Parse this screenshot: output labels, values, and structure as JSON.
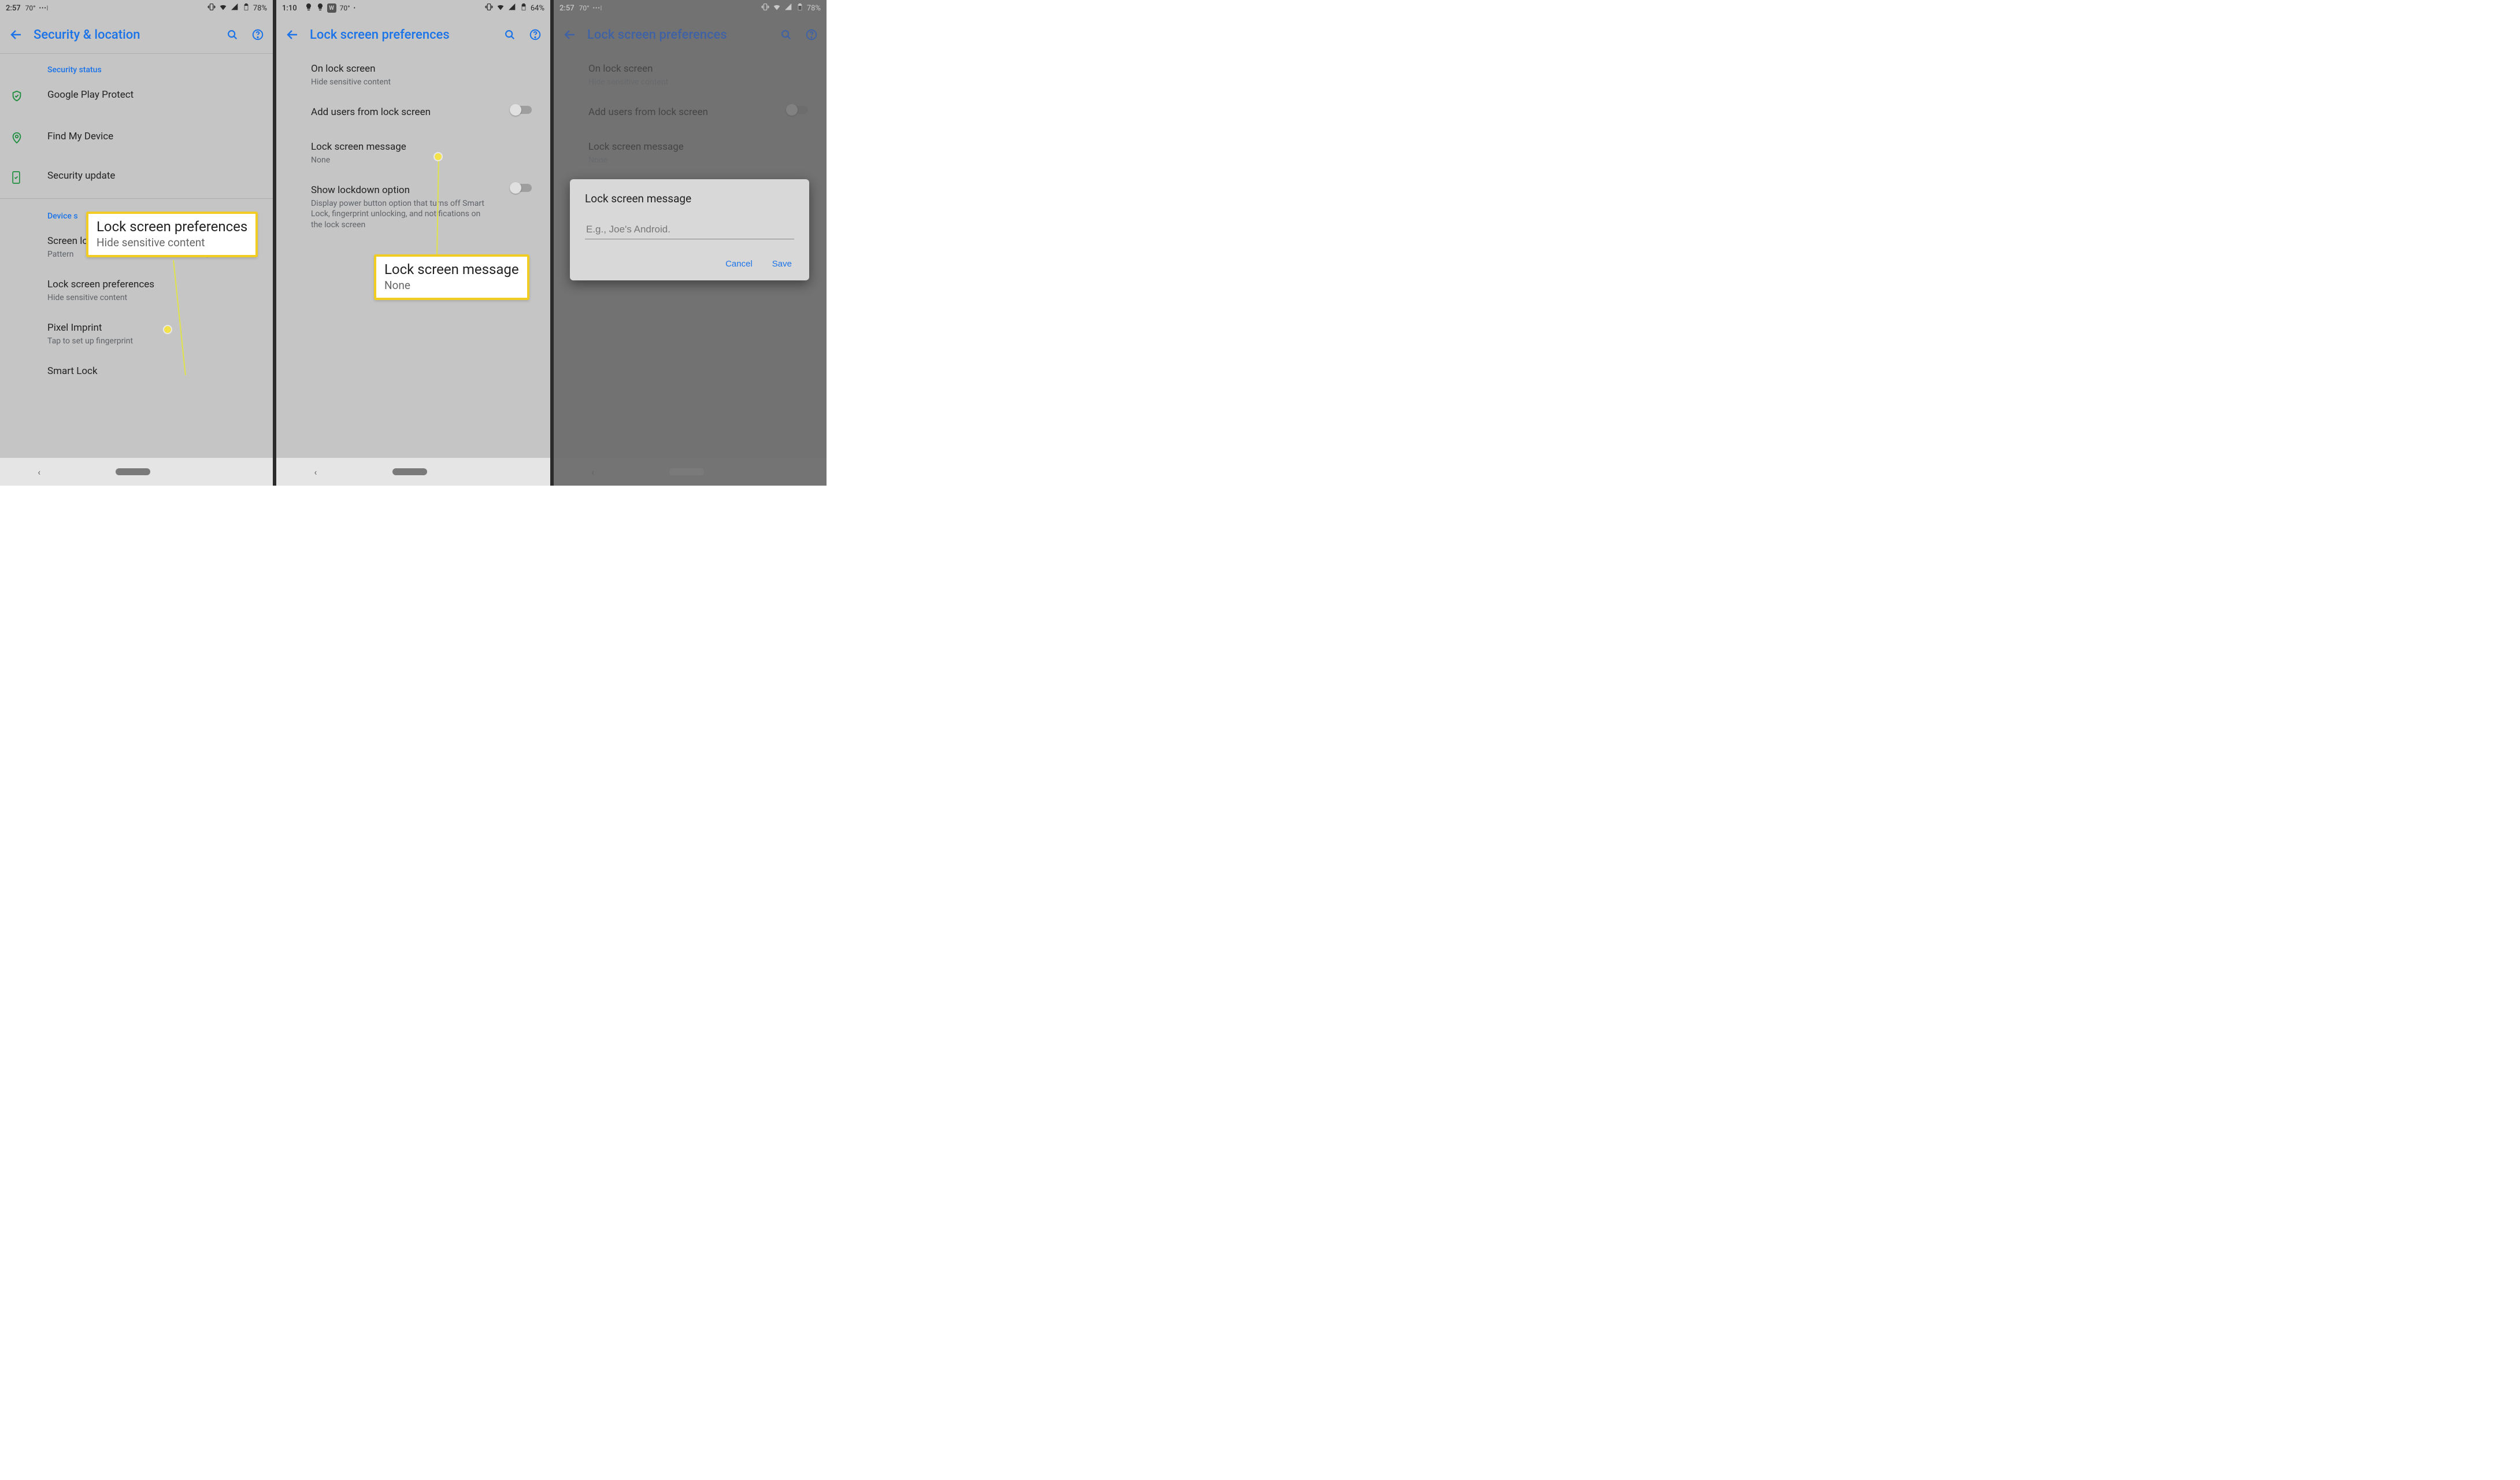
{
  "panel1": {
    "status": {
      "time": "2:57",
      "temp": "70°",
      "extra": "•••|",
      "battery": "78%"
    },
    "title": "Security & location",
    "section_security_status": "Security status",
    "items": {
      "play_protect": "Google Play Protect",
      "find_device": "Find My Device",
      "security_update": "Security update"
    },
    "section_device_security": "Device s",
    "screen_lock": {
      "title": "Screen lock",
      "sub": "Pattern"
    },
    "lock_prefs": {
      "title": "Lock screen preferences",
      "sub": "Hide sensitive content"
    },
    "pixel_imprint": {
      "title": "Pixel Imprint",
      "sub": "Tap to set up fingerprint"
    },
    "smart_lock": "Smart Lock"
  },
  "panel2": {
    "status": {
      "time": "1:10",
      "temp": "70°",
      "extra": "•",
      "battery": "64%"
    },
    "title": "Lock screen preferences",
    "on_lock": {
      "title": "On lock screen",
      "sub": "Hide sensitive content"
    },
    "add_users": "Add users from lock screen",
    "lock_msg": {
      "title": "Lock screen message",
      "sub": "None"
    },
    "lockdown": {
      "title": "Show lockdown option",
      "sub": "Display power button option that turns off Smart Lock, fingerprint unlocking, and notifications on the lock screen"
    }
  },
  "panel3": {
    "status": {
      "time": "2:57",
      "temp": "70°",
      "extra": "•••|",
      "battery": "78%"
    },
    "title": "Lock screen preferences",
    "on_lock": {
      "title": "On lock screen",
      "sub": "Hide sensitive content"
    },
    "add_users": "Add users from lock screen",
    "lock_msg": {
      "title": "Lock screen message",
      "sub": "None"
    },
    "dialog": {
      "title": "Lock screen message",
      "placeholder": "E.g., Joe's Android.",
      "cancel": "Cancel",
      "save": "Save"
    }
  },
  "callout1": {
    "title": "Lock screen preferences",
    "sub": "Hide sensitive content"
  },
  "callout2": {
    "title": "Lock screen message",
    "sub": "None"
  }
}
